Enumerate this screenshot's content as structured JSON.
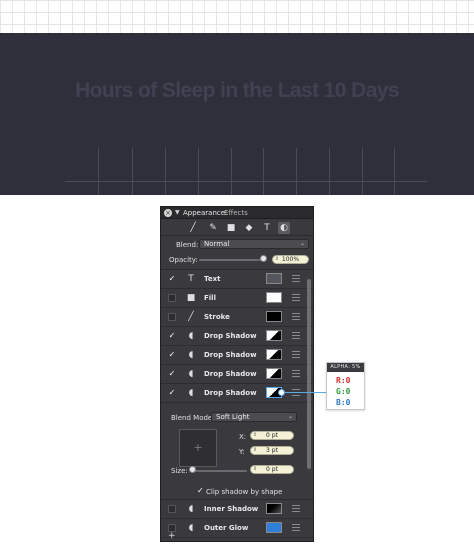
{
  "canvas": {
    "title": "Hours of Sleep in the Last 10 Days",
    "background": "#2e2f3b"
  },
  "panel": {
    "title": "Appearance:",
    "subtitle": "Effects",
    "tools": [
      "line-icon",
      "brush-icon",
      "square-icon",
      "eraser-icon",
      "text-icon",
      "circle-icon"
    ],
    "blend": {
      "label": "Blend:",
      "value": "Normal"
    },
    "opacity": {
      "label": "Opacity:",
      "value": "100%",
      "level": 1.0
    },
    "effects": [
      {
        "label": "Text",
        "checked": true,
        "icon": "text-icon",
        "swatch": "#55565e"
      },
      {
        "label": "Fill",
        "checked": false,
        "icon": "fill-square-icon",
        "swatch": "#ffffff"
      },
      {
        "label": "Stroke",
        "checked": false,
        "icon": "stroke-line-icon",
        "swatch": "#000000"
      },
      {
        "label": "Drop Shadow",
        "checked": true,
        "icon": "shadow-icon",
        "swatch": "split"
      },
      {
        "label": "Drop Shadow",
        "checked": true,
        "icon": "shadow-icon",
        "swatch": "split"
      },
      {
        "label": "Drop Shadow",
        "checked": true,
        "icon": "shadow-icon",
        "swatch": "split"
      },
      {
        "label": "Drop Shadow",
        "checked": true,
        "icon": "shadow-icon",
        "swatch": "split"
      }
    ],
    "detail": {
      "blend_mode_label": "Blend Mode:",
      "blend_mode_value": "Soft Light",
      "x_label": "X:",
      "x_value": "0 pt",
      "y_label": "Y:",
      "y_value": "3 pt",
      "size_label": "Size:",
      "size_value": "0 pt",
      "clip_label": "Clip shadow by shape"
    },
    "bottom_effects": [
      {
        "label": "Inner Shadow",
        "checked": false,
        "icon": "shadow-icon",
        "swatch": "#111111"
      },
      {
        "label": "Outer Glow",
        "checked": false,
        "icon": "shadow-icon",
        "swatch": "#2f7fd8"
      }
    ],
    "add_label": "+"
  },
  "callout": {
    "header": "ALPHA: 5%",
    "r": "R:0",
    "g": "G:0",
    "b": "B:0",
    "r_color": "#d0312d",
    "g_color": "#2e9a3c",
    "b_color": "#2f78c4"
  }
}
